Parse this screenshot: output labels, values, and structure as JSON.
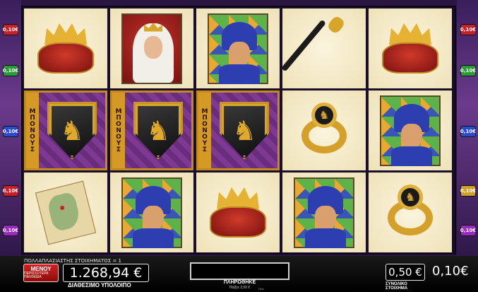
{
  "left_line_badges": [
    {
      "label": "0,10€",
      "color": "#c8202a"
    },
    {
      "label": "0,10€",
      "color": "#2a9a3a"
    },
    {
      "label": "0,10€",
      "color": "#2a4ad0"
    },
    {
      "label": "0,10€",
      "color": "#c8202a"
    },
    {
      "label": "0,10€",
      "color": "#9a2ac0"
    }
  ],
  "right_line_badges": [
    {
      "label": "0,10€",
      "color": "#c8202a"
    },
    {
      "label": "0,10€",
      "color": "#2a9a3a"
    },
    {
      "label": "0,10€",
      "color": "#2a4ad0"
    },
    {
      "label": "0,10€",
      "color": "#d0a02a"
    },
    {
      "label": "0,10€",
      "color": "#9a2ac0"
    }
  ],
  "reels": [
    [
      "crown",
      "bonus-shield",
      "map"
    ],
    [
      "queen",
      "bonus-shield",
      "jester"
    ],
    [
      "jester",
      "bonus-shield",
      "crown"
    ],
    [
      "scepter",
      "ring",
      "jester"
    ],
    [
      "crown",
      "jester",
      "ring"
    ]
  ],
  "bonus": {
    "label": "ΜΠΟΝΟΥΣ"
  },
  "footer": {
    "multiplier_text": "ΠΟΛΛΑΠΛΑΣΙΑΣΤΗΣ ΣΤΟΙΧΗΜΑΤΟΣ = 1",
    "menu_main": "ΜΕΝΟΥ",
    "menu_sub": "ΠΕΡΙΣΣΟΤΕΡΑ ΠΑΙΧΝΙΔΙΑ",
    "balance_value": "1.268,94 €",
    "balance_label": "ΔΙΑΘΕΣΙΜΟ ΥΠΟΛΟΙΠΟ",
    "win_value": "",
    "win_label": "ΠΛΗΡΩΘΗΚΕ",
    "bet_info": "Παίξτε 2,00 €",
    "mini_label": "Ποσ",
    "bet_value": "0,50 €",
    "bet_label": "ΣΥΝΟΛΙΚΟ ΣΤΟΙΧΗΜΑ",
    "line_bet": "0,10€"
  }
}
